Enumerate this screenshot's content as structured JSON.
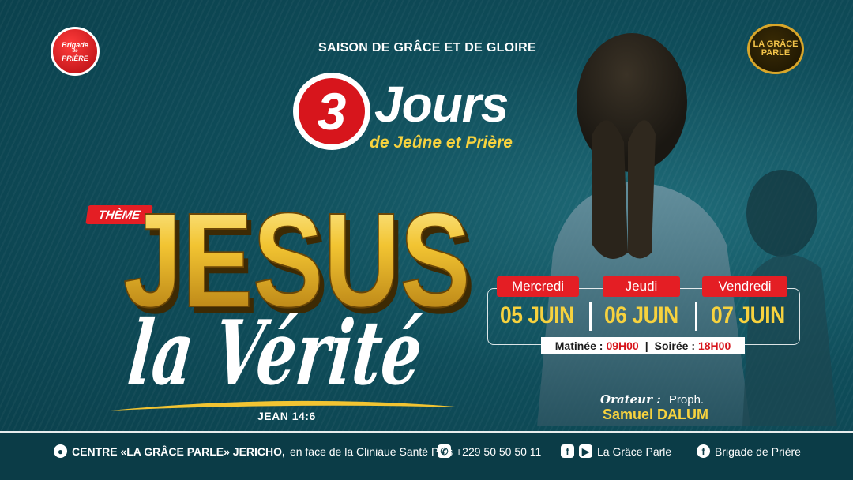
{
  "brand": {
    "left_logo_line1": "Brigade",
    "left_logo_line2": "de",
    "left_logo_line3": "PRIÈRE",
    "right_logo_line1": "LA GRÂCE",
    "right_logo_line2": "PARLE"
  },
  "header": {
    "season": "SAISON DE GRÂCE ET DE GLOIRE",
    "days_number": "3",
    "days_word": "Jours",
    "subtitle": "de Jeûne et Prière"
  },
  "theme": {
    "label": "THÈME",
    "title_main": "JESUS",
    "title_script": "la Vérité",
    "verse": "JEAN 14:6"
  },
  "schedule": {
    "days": [
      {
        "day": "Mercredi",
        "date": "05 JUIN"
      },
      {
        "day": "Jeudi",
        "date": "06 JUIN"
      },
      {
        "day": "Vendredi",
        "date": "07 JUIN"
      }
    ],
    "morning_label": "Matinée :",
    "morning_time": "09H00",
    "separator": "|",
    "evening_label": "Soirée :",
    "evening_time": "18H00"
  },
  "speaker": {
    "label": "Orateur :",
    "role": "Proph.",
    "name": "Samuel DALUM"
  },
  "footer": {
    "location_bold": "CENTRE «LA GRÂCE PARLE» JERICHO,",
    "location_rest": "en face de la Cliniaue Santé Plus",
    "phone": "+229 50 50 50 11",
    "social1": "La Grâce Parle",
    "social2": "Brigade de Prière"
  },
  "colors": {
    "background": "#0d4a57",
    "accent_red": "#e41e24",
    "accent_yellow": "#f7d23e",
    "gold": "#d8a62a"
  }
}
